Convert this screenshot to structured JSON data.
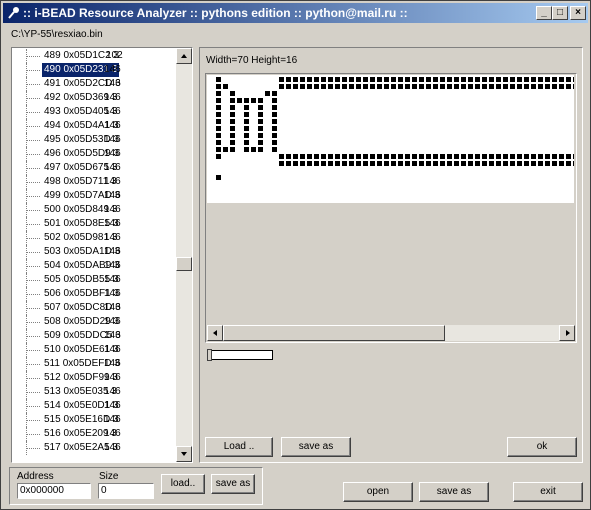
{
  "window": {
    "title": ":: i-BEAD Resource Analyzer :: pythons edition :: python@mail.ru ::",
    "minimize_label": "_",
    "maximize_label": "□",
    "close_label": "×"
  },
  "file_path": "C:\\YP-55\\resxiao.bin",
  "tree": {
    "selected_index": 1,
    "items": [
      {
        "label": "489 0x05D1C2 3",
        "value": "102"
      },
      {
        "label": "490 0x05D231 3",
        "value": "146"
      },
      {
        "label": "491 0x05D2CD 3",
        "value": "146"
      },
      {
        "label": "492 0x05D369 3",
        "value": "146"
      },
      {
        "label": "493 0x05D405 3",
        "value": "146"
      },
      {
        "label": "494 0x05D4A1 3",
        "value": "146"
      },
      {
        "label": "495 0x05D53D 3",
        "value": "146"
      },
      {
        "label": "496 0x05D5D9 3",
        "value": "146"
      },
      {
        "label": "497 0x05D675 3",
        "value": "146"
      },
      {
        "label": "498 0x05D711 3",
        "value": "146"
      },
      {
        "label": "499 0x05D7AD 3",
        "value": "146"
      },
      {
        "label": "500 0x05D849 3",
        "value": "146"
      },
      {
        "label": "501 0x05D8E5 3",
        "value": "146"
      },
      {
        "label": "502 0x05D981 3",
        "value": "146"
      },
      {
        "label": "503 0x05DA1D 3",
        "value": "146"
      },
      {
        "label": "504 0x05DAB9 3",
        "value": "146"
      },
      {
        "label": "505 0x05DB55 3",
        "value": "146"
      },
      {
        "label": "506 0x05DBF1 3",
        "value": "146"
      },
      {
        "label": "507 0x05DC8D 3",
        "value": "146"
      },
      {
        "label": "508 0x05DD29 3",
        "value": "146"
      },
      {
        "label": "509 0x05DDC5 3",
        "value": "146"
      },
      {
        "label": "510 0x05DE61 3",
        "value": "146"
      },
      {
        "label": "511 0x05DEFD 3",
        "value": "146"
      },
      {
        "label": "512 0x05DF99 3",
        "value": "146"
      },
      {
        "label": "513 0x05E035 3",
        "value": "146"
      },
      {
        "label": "514 0x05E0D1 3",
        "value": "146"
      },
      {
        "label": "515 0x05E16D 3",
        "value": "146"
      },
      {
        "label": "516 0x05E209 3",
        "value": "146"
      },
      {
        "label": "517 0x05E2A5 3",
        "value": "146"
      }
    ]
  },
  "image_info": "Width=70 Height=16",
  "image_buttons": {
    "load": "Load ..",
    "save_as": "save as",
    "ok": "ok"
  },
  "address": {
    "label": "Address",
    "value": "0x000000"
  },
  "size": {
    "label": "Size",
    "value": "0"
  },
  "bottom_buttons": {
    "load": "load..",
    "save_as": "save as",
    "open": "open",
    "save_as_file": "save as",
    "exit": "exit"
  }
}
